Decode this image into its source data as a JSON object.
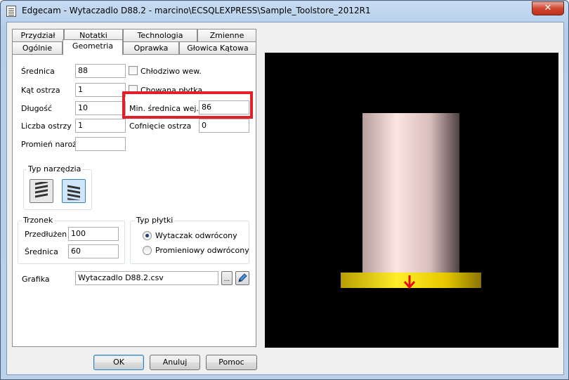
{
  "window": {
    "title": "Edgecam - Wytaczadlo D88.2 - marcino\\ECSQLEXPRESS\\Sample_Toolstore_2012R1",
    "close_glyph": "✕"
  },
  "tabs_back": [
    {
      "label": "Przydział"
    },
    {
      "label": "Notatki"
    },
    {
      "label": "Technologia"
    },
    {
      "label": "Zmienne"
    }
  ],
  "tabs_front": [
    {
      "label": "Ogólnie"
    },
    {
      "label": "Geometria",
      "active": true
    },
    {
      "label": "Oprawka"
    },
    {
      "label": "Głowica Kątowa"
    }
  ],
  "fields": {
    "srednica": {
      "label": "Średnica",
      "value": "88"
    },
    "kat_ostrza": {
      "label": "Kąt ostrza",
      "value": "1"
    },
    "dlugosc": {
      "label": "Długość",
      "value": "10"
    },
    "liczba_ostrzy": {
      "label": "Liczba ostrzy",
      "value": "1"
    },
    "promien_naroza": {
      "label": "Promień naroża",
      "value": ""
    },
    "min_srednica": {
      "label": "Min. średnica wej.",
      "value": "86"
    },
    "cofniecie": {
      "label": "Cofnięcie ostrza",
      "value": "0"
    }
  },
  "checkboxes": {
    "chlodziwo": {
      "label": "Chłodziwo wew.",
      "checked": false
    },
    "chowana": {
      "label": "Chowana płytka",
      "checked": false
    }
  },
  "typ_narzedzia": {
    "title": "Typ narzędzia"
  },
  "trzonek": {
    "title": "Trzonek",
    "przedluzenie": {
      "label": "Przedłużen",
      "value": "100"
    },
    "srednica": {
      "label": "Średnica",
      "value": "60"
    }
  },
  "typ_plytki": {
    "title": "Typ płytki",
    "options": [
      {
        "label": "Wytaczak odwrócony",
        "selected": true
      },
      {
        "label": "Promieniowy odwrócony",
        "selected": false
      }
    ]
  },
  "grafika": {
    "label": "Grafika",
    "value": "Wytaczadlo D88.2.csv",
    "browse_label": "..."
  },
  "buttons": {
    "ok": "OK",
    "anuluj": "Anuluj",
    "pomoc": "Pomoc"
  },
  "colors": {
    "highlight": "#e0202a",
    "viewport_bg": "#000000",
    "tool_body": "#f2d2d0",
    "tool_flange": "#f5d800",
    "arrow": "#e01010"
  }
}
